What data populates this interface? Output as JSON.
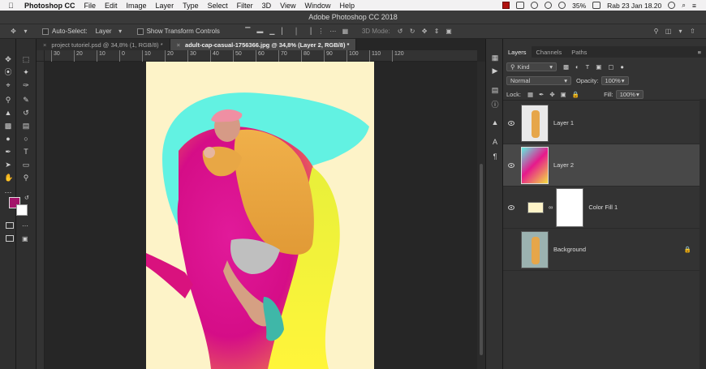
{
  "menubar": {
    "app": "Photoshop CC",
    "items": [
      "File",
      "Edit",
      "Image",
      "Layer",
      "Type",
      "Select",
      "Filter",
      "3D",
      "View",
      "Window",
      "Help"
    ],
    "battery": "35%",
    "datetime": "Rab 23 Jan  18.20"
  },
  "window": {
    "title": "Adobe Photoshop CC 2018"
  },
  "options": {
    "auto_select_label": "Auto-Select:",
    "auto_select_value": "Layer",
    "show_transform_label": "Show Transform Controls",
    "mode_3d_label": "3D Mode:"
  },
  "tabs": [
    {
      "label": "project tutoriel.psd @ 34,8% (1, RGB/8) *"
    },
    {
      "label": "adult-cap-casual-1756366.jpg @ 34,8% (Layer 2, RGB/8) *"
    }
  ],
  "ruler": {
    "ticks": [
      "30",
      "20",
      "10",
      "0",
      "10",
      "20",
      "30",
      "40",
      "50",
      "60",
      "70",
      "80",
      "90",
      "100",
      "110",
      "120"
    ]
  },
  "panel": {
    "tabs": [
      "Layers",
      "Channels",
      "Paths"
    ],
    "filter_kind": "Kind",
    "blend_mode": "Normal",
    "opacity_label": "Opacity:",
    "opacity_value": "100%",
    "lock_label": "Lock:",
    "fill_label": "Fill:",
    "fill_value": "100%",
    "layers": [
      {
        "name": "Layer 1"
      },
      {
        "name": "Layer 2"
      },
      {
        "name": "Color Fill 1"
      },
      {
        "name": "Background"
      }
    ]
  },
  "colors": {
    "foreground": "#a3146a",
    "background": "#ffffff",
    "canvas_bg": "#fdf3c8",
    "accent_cyan": "#5ff0e0",
    "accent_magenta": "#e6198c",
    "accent_yellow": "#f5f33a"
  }
}
